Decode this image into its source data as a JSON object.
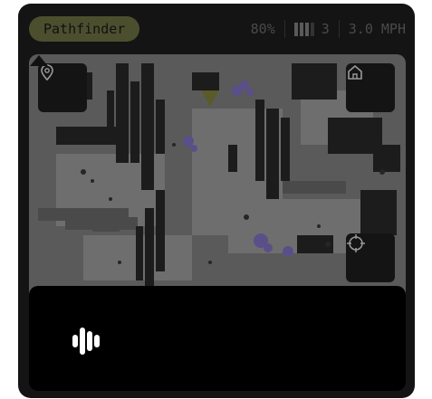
{
  "header": {
    "app_name": "Pathfinder",
    "battery": "80%",
    "signal_count": "3",
    "speed": "3.0 MPH"
  },
  "map": {
    "buttons": {
      "location": "map-pin-icon",
      "home": "home-icon",
      "recenter": "crosshair-icon"
    },
    "robot_marker": "triangle-icon"
  },
  "bottom_panel": {
    "voice_button": "audio-waveform-icon"
  },
  "colors": {
    "accent_pill": "#4c4f2e",
    "device_bg": "#141414",
    "map_bg": "#3b3b3b",
    "panel_bg": "#000000"
  }
}
